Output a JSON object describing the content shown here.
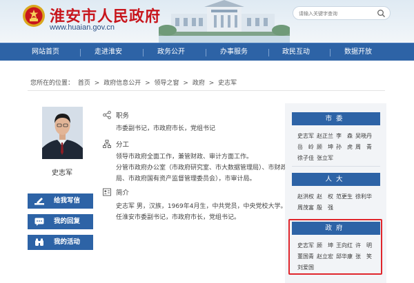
{
  "header": {
    "title": "淮安市人民政府",
    "url": "www.huaian.gov.cn",
    "search_placeholder": "请输入关键字查询"
  },
  "nav": {
    "items": [
      "网站首页",
      "走进淮安",
      "政务公开",
      "办事服务",
      "政民互动",
      "数据开放"
    ]
  },
  "breadcrumb": {
    "prefix": "您所在的位置：",
    "items": [
      "首页",
      "政府信息公开",
      "领导之窗",
      "政府",
      "史志军"
    ],
    "separator": ">"
  },
  "profile": {
    "name": "史志军",
    "buttons": [
      "给我写信",
      "我的回复",
      "我的活动"
    ]
  },
  "sections": {
    "duty_title": "职务",
    "duty_text": "市委副书记，市政府市长，党组书记",
    "work_title": "分工",
    "work_lines": [
      "领导市政府全面工作，兼管财政、审计方面工作。",
      "分管市政府办公室（市政府研究室、市大数据管理局）、市财政局",
      "局、市政府国有资产监督管理委员会），市审计局。"
    ],
    "bio_title": "简介",
    "bio_lines": [
      "史志军 男，汉族，1969年4月生，中共党员，中央党校大学。现",
      "任淮安市委副书记，市政府市长，党组书记。"
    ]
  },
  "leaders": {
    "party_committee": {
      "title": "市委",
      "rows": [
        [
          "史志军",
          "赵正兰",
          "李　森",
          "吴晓丹"
        ],
        [
          "岳　岭",
          "顾　坤",
          "孙　虎",
          "周　青"
        ],
        [
          "徐子佳",
          "张立军"
        ]
      ]
    },
    "peoples_congress": {
      "title": "人大",
      "rows": [
        [
          "赵洪权",
          "赵　权",
          "范更生",
          "徐利华"
        ],
        [
          "周茂富",
          "殷　强"
        ]
      ]
    },
    "government": {
      "title": "政府",
      "rows": [
        [
          "史志军",
          "顾　坤",
          "王向红",
          "许　明"
        ],
        [
          "董国青",
          "赵立宏",
          "邱华康",
          "张　笑"
        ],
        [
          "刘爱国"
        ]
      ]
    }
  },
  "colors": {
    "nav_blue": "#2d63a6",
    "title_red": "#c8161d",
    "highlight_red": "#e0252b"
  }
}
